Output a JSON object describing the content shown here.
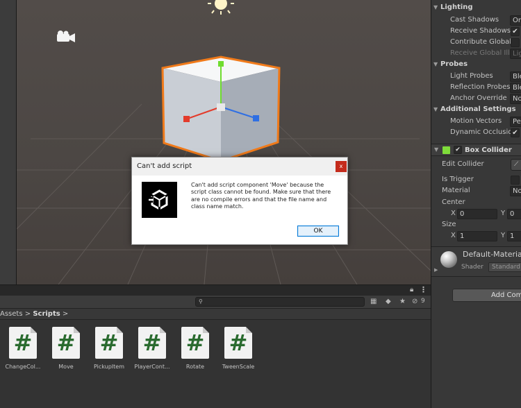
{
  "inspector": {
    "lighting": {
      "header": "Lighting",
      "cast_shadows_label": "Cast Shadows",
      "cast_shadows_value": "On",
      "receive_shadows_label": "Receive Shadows",
      "contribute_gi_label": "Contribute Global I",
      "receive_gi_label": "Receive Global Illu",
      "receive_gi_value": "Lig"
    },
    "probes": {
      "header": "Probes",
      "light_probes_label": "Light Probes",
      "light_probes_value": "Ble",
      "reflection_probes_label": "Reflection Probes",
      "reflection_probes_value": "Ble",
      "anchor_override_label": "Anchor Override",
      "anchor_override_value": "No"
    },
    "additional": {
      "header": "Additional Settings",
      "motion_vectors_label": "Motion Vectors",
      "motion_vectors_value": "Pe",
      "dynamic_occlusion_label": "Dynamic Occlusio"
    },
    "box_collider": {
      "header": "Box Collider",
      "edit_collider_label": "Edit Collider",
      "is_trigger_label": "Is Trigger",
      "material_label": "Material",
      "material_value": "No",
      "center_label": "Center",
      "center_x": "0",
      "center_y": "0",
      "size_label": "Size",
      "size_x": "1",
      "size_y": "1",
      "axis_x": "X",
      "axis_y": "Y"
    },
    "material": {
      "name": "Default-Material",
      "shader_label": "Shader",
      "shader_value": "Standard"
    },
    "add_component_label": "Add Comp",
    "check_mark": "✔"
  },
  "dialog": {
    "title": "Can't add script",
    "close_label": "x",
    "message": "Can't add script component 'Move' because the script class cannot be found. Make sure that there are no compile errors and that the file name and class name match.",
    "ok_label": "OK"
  },
  "project": {
    "breadcrumb": {
      "root": "Assets",
      "sep": ">",
      "current": "Scripts"
    },
    "visibility_count": "9",
    "assets": [
      {
        "name": "ChangeCol..."
      },
      {
        "name": "Move"
      },
      {
        "name": "PickupItem"
      },
      {
        "name": "PlayerCont..."
      },
      {
        "name": "Rotate"
      },
      {
        "name": "TweenScale"
      }
    ],
    "hash_glyph": "#"
  },
  "colors": {
    "selection_outline": "#f07a1a",
    "axis_x": "#e33b2b",
    "axis_y": "#6fdc2f",
    "axis_z": "#2f6fe3",
    "script_icon": "#2a6b2f",
    "close_button": "#c42b1c"
  }
}
